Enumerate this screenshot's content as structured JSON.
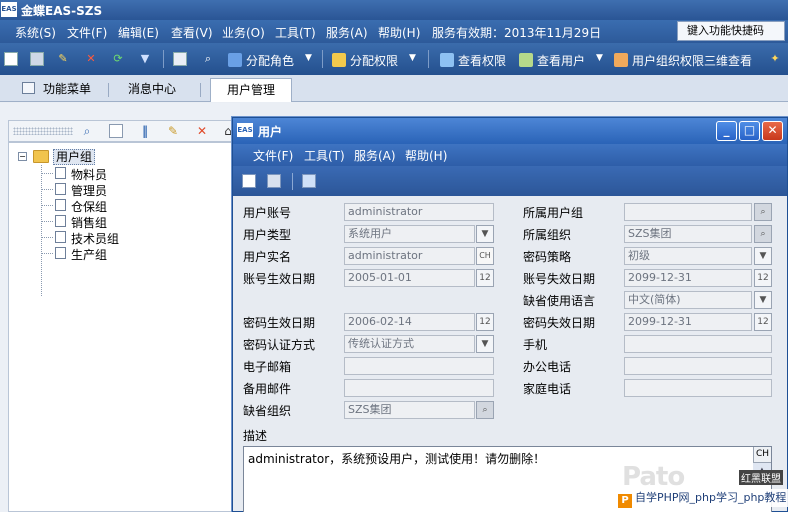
{
  "app": {
    "title": "金蝶EAS-SZS",
    "logo_text": "EAS"
  },
  "menubar": {
    "items": [
      "系统(S)",
      "文件(F)",
      "编辑(E)",
      "查看(V)",
      "业务(O)",
      "工具(T)",
      "服务(A)",
      "帮助(H)"
    ],
    "service_expiry": "服务有效期：2013年11月29日",
    "shortcut_placeholder": "键入功能快捷码"
  },
  "toolbar": {
    "assign_role": "分配角色",
    "assign_permission": "分配权限",
    "view_permission": "查看权限",
    "view_user": "查看用户",
    "org_permission_3d": "用户组织权限三维查看"
  },
  "tabs": [
    "功能菜单",
    "消息中心",
    "用户管理"
  ],
  "tree": {
    "root": "用户组",
    "children": [
      "物料员",
      "管理员",
      "仓保组",
      "销售组",
      "技术员组",
      "生产组"
    ]
  },
  "dialog": {
    "title": "用户",
    "logo_text": "EAS",
    "menu": [
      "文件(F)",
      "工具(T)",
      "服务(A)",
      "帮助(H)"
    ],
    "fields": {
      "user_account": {
        "label": "用户账号",
        "value": "administrator"
      },
      "user_type": {
        "label": "用户类型",
        "value": "系统用户"
      },
      "real_name": {
        "label": "用户实名",
        "value": "administrator"
      },
      "account_effective_date": {
        "label": "账号生效日期",
        "value": "2005-01-01"
      },
      "password_effective_date": {
        "label": "密码生效日期",
        "value": "2006-02-14"
      },
      "password_auth_method": {
        "label": "密码认证方式",
        "value": "传统认证方式"
      },
      "email": {
        "label": "电子邮箱",
        "value": ""
      },
      "backup_email": {
        "label": "备用邮件",
        "value": ""
      },
      "default_org": {
        "label": "缺省组织",
        "value": "SZS集团"
      },
      "user_group": {
        "label": "所属用户组",
        "value": ""
      },
      "organization": {
        "label": "所属组织",
        "value": "SZS集团"
      },
      "password_policy": {
        "label": "密码策略",
        "value": "初级"
      },
      "account_expiry_date": {
        "label": "账号失效日期",
        "value": "2099-12-31"
      },
      "default_language": {
        "label": "缺省使用语言",
        "value": "中文(简体)"
      },
      "password_expiry_date": {
        "label": "密码失效日期",
        "value": "2099-12-31"
      },
      "mobile": {
        "label": "手机",
        "value": ""
      },
      "office_phone": {
        "label": "办公电话",
        "value": ""
      },
      "home_phone": {
        "label": "家庭电话",
        "value": ""
      }
    },
    "description": {
      "label": "描述",
      "value": "administrator，系统预设用户，测试使用！请勿删除！"
    },
    "ch_label": "CH"
  },
  "watermark": {
    "logo": "Pato",
    "corner_text": "红黑联盟",
    "bar_text": "自学PHP网_php学习_php教程"
  },
  "colors": {
    "title_bar": "#2a5595",
    "dialog_title": "#2a63b7",
    "close_button": "#c8381c"
  }
}
